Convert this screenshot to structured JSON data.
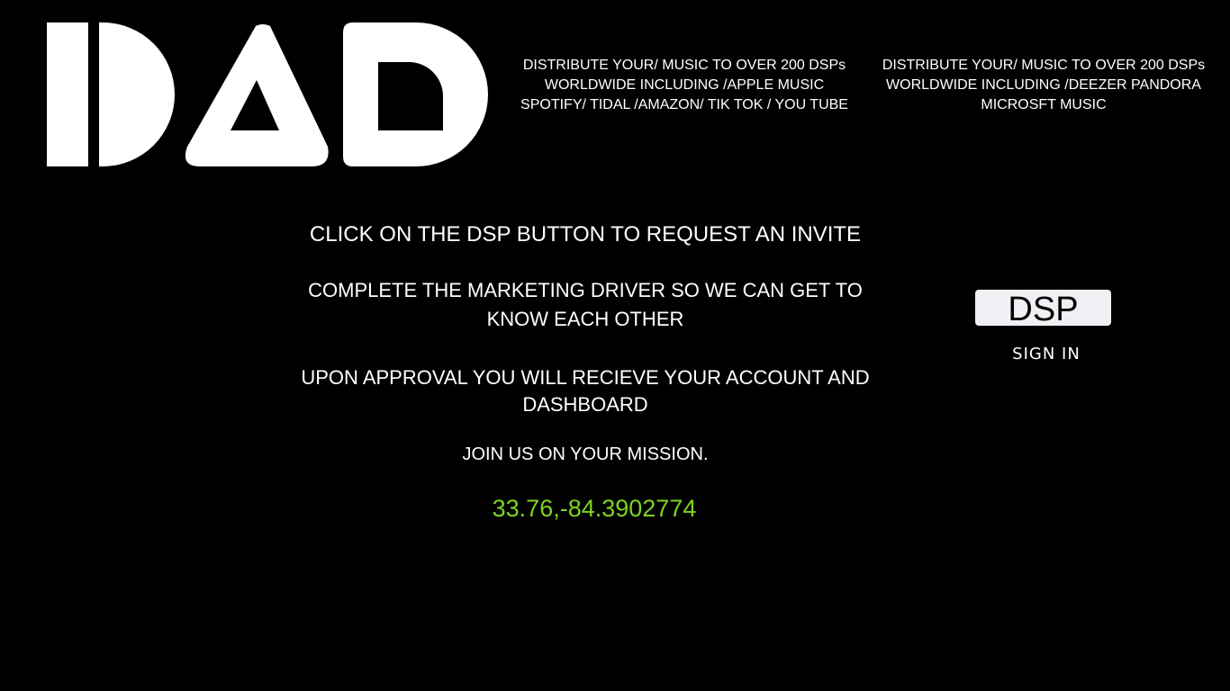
{
  "logo": {
    "text": "DAD",
    "color": "#ffffff"
  },
  "header": {
    "left_blurb": [
      "DISTRIBUTE YOUR/ MUSIC TO OVER 200 DSPs",
      "WORLDWIDE INCLUDING /APPLE MUSIC",
      "SPOTIFY/ TIDAL /AMAZON/ TIK TOK / YOU TUBE"
    ],
    "right_blurb": [
      "DISTRIBUTE YOUR/ MUSIC TO OVER 200 DSPs",
      "WORLDWIDE INCLUDING /DEEZER PANDORA",
      "MICROSFT MUSIC"
    ]
  },
  "main": {
    "line1": "CLICK ON THE DSP BUTTON TO REQUEST AN INVITE",
    "line2": [
      "COMPLETE THE MARKETING DRIVER  SO WE CAN GET TO",
      "KNOW EACH OTHER"
    ],
    "line3": [
      "UPON APPROVAL YOU WILL RECIEVE YOUR ACCOUNT AND",
      "DASHBOARD"
    ],
    "line4": "JOIN US ON YOUR MISSION.",
    "coords": "33.76,-84.3902774"
  },
  "actions": {
    "dsp_label": "DSP",
    "signin_label": "SIGN IN"
  },
  "colors": {
    "background": "#000000",
    "text": "#ffffff",
    "accent_green": "#7ed321",
    "button_bg": "#eef0f3"
  }
}
